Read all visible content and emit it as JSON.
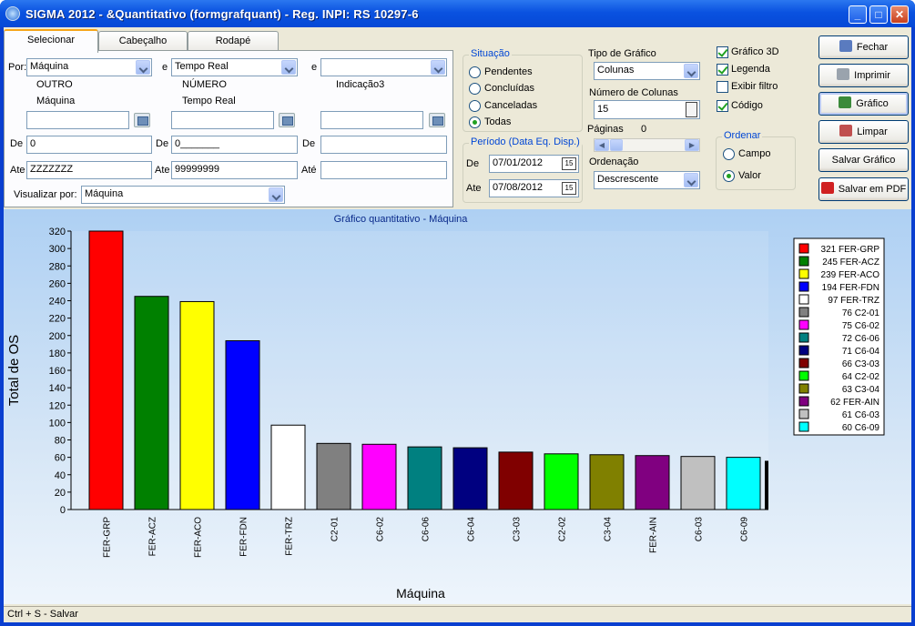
{
  "window": {
    "title": "SIGMA 2012 - &Quantitativo  (formgrafquant)  - Reg. INPI: RS 10297-6"
  },
  "tabs": [
    "Selecionar",
    "Cabeçalho",
    "Rodapé"
  ],
  "filters": {
    "por_label": "Por:",
    "e_label": "e",
    "por1": "Máquina",
    "por2": "Tempo Real",
    "por3": "",
    "col1_caption1": "OUTRO",
    "col1_caption2": "Máquina",
    "col2_caption1": "NÚMERO",
    "col2_caption2": "Tempo Real",
    "col3_caption1": "Indicação3",
    "de_label": "De",
    "ate_label": "Ate",
    "ate_label3": "Até",
    "de1": "0",
    "de2": "0_______",
    "de3": "",
    "ate1": "ZZZZZZZ",
    "ate2": "99999999",
    "ate3": "",
    "visualizar_label": "Visualizar por:",
    "visualizar": "Máquina"
  },
  "situacao": {
    "label": "Situação",
    "options": [
      "Pendentes",
      "Concluídas",
      "Canceladas",
      "Todas"
    ],
    "selected": "Todas"
  },
  "periodo": {
    "label": "Período (Data Eq. Disp.)",
    "de_label": "De",
    "ate_label": "Ate",
    "de": "07/01/2012",
    "ate": "07/08/2012",
    "cal_icon": "15"
  },
  "tipo": {
    "label": "Tipo de Gráfico",
    "value": "Colunas",
    "num_cols_label": "Número de Colunas",
    "num_cols": "15",
    "paginas_label": "Páginas",
    "paginas": "0",
    "ordenacao_label": "Ordenação",
    "ordenacao": "Descrescente"
  },
  "options": [
    {
      "label": "Gráfico 3D",
      "checked": true
    },
    {
      "label": "Legenda",
      "checked": true
    },
    {
      "label": "Exibir filtro",
      "checked": false
    },
    {
      "label": "Código",
      "checked": true
    }
  ],
  "ordenar": {
    "label": "Ordenar",
    "options": [
      "Campo",
      "Valor"
    ],
    "selected": "Valor"
  },
  "buttons": [
    {
      "label": "Fechar",
      "icon": "door-icon",
      "color": "#5a7bbf"
    },
    {
      "label": "Imprimir",
      "icon": "printer-icon",
      "color": "#9aa3ad"
    },
    {
      "label": "Gráfico",
      "icon": "chart-icon",
      "color": "#3b8a3b"
    },
    {
      "label": "Limpar",
      "icon": "eraser-icon",
      "color": "#c05050"
    },
    {
      "label": "Salvar Gráfico",
      "icon": "",
      "color": ""
    },
    {
      "label": "Salvar em PDF",
      "icon": "pdf-icon",
      "color": "#d02020"
    }
  ],
  "chart_data": {
    "type": "bar",
    "title": "Gráfico quantitativo - Máquina",
    "xlabel": "Máquina",
    "ylabel": "Total de OS",
    "ylim": [
      0,
      320
    ],
    "yticks": [
      0,
      20,
      40,
      60,
      80,
      100,
      120,
      140,
      160,
      180,
      200,
      220,
      240,
      260,
      280,
      300,
      320
    ],
    "categories": [
      "FER-GRP",
      "FER-ACZ",
      "FER-ACO",
      "FER-FDN",
      "FER-TRZ",
      "C2-01",
      "C6-02",
      "C6-06",
      "C6-04",
      "C3-03",
      "C2-02",
      "C3-04",
      "FER-AIN",
      "C6-03",
      "C6-09"
    ],
    "values": [
      321,
      245,
      239,
      194,
      97,
      76,
      75,
      72,
      71,
      66,
      64,
      63,
      62,
      61,
      60
    ],
    "colors": [
      "#ff0000",
      "#008000",
      "#ffff00",
      "#0000ff",
      "#ffffff",
      "#808080",
      "#ff00ff",
      "#008080",
      "#000080",
      "#800000",
      "#00ff00",
      "#808000",
      "#800080",
      "#c0c0c0",
      "#00ffff"
    ],
    "legend": [
      "321 FER-GRP",
      "245 FER-ACZ",
      "239 FER-ACO",
      "194 FER-FDN",
      "97 FER-TRZ",
      "76 C2-01",
      "75 C6-02",
      "72 C6-06",
      "71 C6-04",
      "66 C3-03",
      "64 C2-02",
      "63 C3-04",
      "62 FER-AIN",
      "61 C6-03",
      "60 C6-09"
    ],
    "legend_position": "right",
    "grid": false
  },
  "status": {
    "text": "Ctrl + S - Salvar"
  }
}
